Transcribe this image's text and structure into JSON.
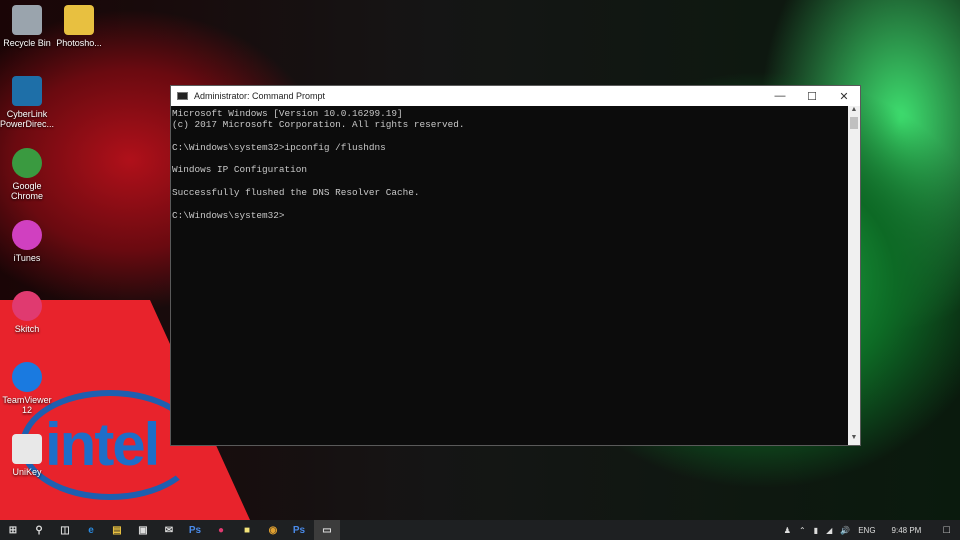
{
  "desktop": {
    "icons": [
      {
        "label": "Recycle Bin",
        "icon": "recycle-bin-icon",
        "color": "#9aa4ad"
      },
      {
        "label": "Photosho...",
        "icon": "folder-icon",
        "color": "#e8c040"
      },
      {
        "label": "CyberLink PowerDirec...",
        "icon": "powerdirector-icon",
        "color": "#1e6fa8"
      },
      {
        "label": "Google Chrome",
        "icon": "chrome-icon",
        "color": "#3a9a40"
      },
      {
        "label": "iTunes",
        "icon": "itunes-icon",
        "color": "#d040c0"
      },
      {
        "label": "Skitch",
        "icon": "skitch-icon",
        "color": "#e03a70"
      },
      {
        "label": "TeamViewer 12",
        "icon": "teamviewer-icon",
        "color": "#1a7ae0"
      },
      {
        "label": "UniKey",
        "icon": "unikey-icon",
        "color": "#e8e8e8"
      }
    ]
  },
  "window": {
    "title": "Administrator: Command Prompt",
    "lines": [
      "Microsoft Windows [Version 10.0.16299.19]",
      "(c) 2017 Microsoft Corporation. All rights reserved.",
      "",
      "C:\\Windows\\system32>ipconfig /flushdns",
      "",
      "Windows IP Configuration",
      "",
      "Successfully flushed the DNS Resolver Cache.",
      "",
      "C:\\Windows\\system32>"
    ]
  },
  "taskbar": {
    "apps": [
      "start",
      "search",
      "task-view",
      "edge",
      "file-explorer",
      "store",
      "mail",
      "photoshop",
      "skitch",
      "sticky-notes",
      "chrome",
      "photoshop-2",
      "command-prompt"
    ],
    "tray": {
      "language": "ENG",
      "time": "9:48 PM"
    }
  },
  "colors": {
    "console_bg": "#0c0c0c",
    "console_text": "#c8c8c8",
    "taskbar": "#1e2022"
  }
}
